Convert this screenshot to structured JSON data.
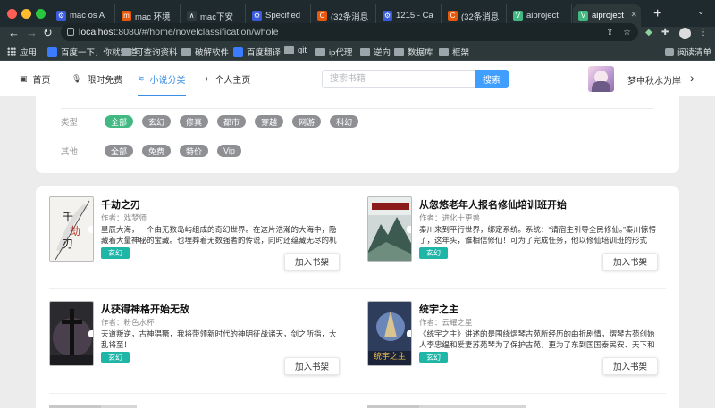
{
  "browser": {
    "tabs": [
      {
        "label": "mac os A",
        "fav_color": "#3b5bdb",
        "fav_glyph": "⚙"
      },
      {
        "label": "mac 环境",
        "fav_color": "#e8590c",
        "fav_glyph": "m"
      },
      {
        "label": "mac下安",
        "fav_color": "#2f3a3d",
        "fav_glyph": "∧"
      },
      {
        "label": "Specified",
        "fav_color": "#3b5bdb",
        "fav_glyph": "⚙"
      },
      {
        "label": "(32条消息",
        "fav_color": "#e8590c",
        "fav_glyph": "C"
      },
      {
        "label": "1215 - Ca",
        "fav_color": "#3b5bdb",
        "fav_glyph": "⚙"
      },
      {
        "label": "(32条消息",
        "fav_color": "#e8590c",
        "fav_glyph": "C"
      },
      {
        "label": "aiproject",
        "fav_color": "#42b983",
        "fav_glyph": "V"
      },
      {
        "label": "aiproject",
        "fav_color": "#42b983",
        "fav_glyph": "V"
      }
    ],
    "active_tab_index": 8,
    "url_host": "localhost",
    "url_path": ":8080/#/home/novelclassification/whole",
    "bookmarks": [
      {
        "label": "应用",
        "kind": "apps"
      },
      {
        "label": "百度一下，你就知道",
        "kind": "site",
        "color": "#3b7bff"
      },
      {
        "label": "可查询资料",
        "kind": "folder"
      },
      {
        "label": "破解软件",
        "kind": "folder"
      },
      {
        "label": "百度翻译",
        "kind": "site",
        "color": "#3b7bff"
      },
      {
        "label": "git",
        "kind": "folder"
      },
      {
        "label": "ip代理",
        "kind": "folder"
      },
      {
        "label": "逆向",
        "kind": "folder"
      },
      {
        "label": "数据库",
        "kind": "folder"
      },
      {
        "label": "框架",
        "kind": "folder"
      }
    ],
    "reading_list": "阅读清单"
  },
  "site_nav": {
    "items": [
      {
        "label": "首页",
        "icon": "▣",
        "active": false
      },
      {
        "label": "限时免费",
        "icon": "🎙",
        "active": false
      },
      {
        "label": "小说分类",
        "icon": "≋",
        "active": true
      },
      {
        "label": "个人主页",
        "icon": "◐",
        "active": false
      }
    ],
    "search_placeholder": "搜索书籍",
    "search_button": "搜索",
    "username": "梦中秋水为岸"
  },
  "filters": {
    "rows": [
      {
        "label": "类型",
        "chips": [
          "全部",
          "玄幻",
          "修真",
          "都市",
          "穿越",
          "网游",
          "科幻"
        ],
        "active_index": 0
      },
      {
        "label": "其他",
        "chips": [
          "全部",
          "免费",
          "特价",
          "Vip"
        ],
        "active_index": -1
      }
    ]
  },
  "books": [
    {
      "title": "千劫之刃",
      "author_prefix": "作者：",
      "author": "戏梦师",
      "description": "星辰大海，一个由无数岛屿组成的奇幻世界。在这片浩瀚的大海中，隐藏着大量神秘的宝藏。也埋葬着无数强者的传说，同时还蕴藏无尽的机遇…",
      "tag": "玄幻",
      "add_label": "加入书架",
      "cover": "blade"
    },
    {
      "title": "从忽悠老年人报名修仙培训班开始",
      "author_prefix": "作者：",
      "author": "进化十更兽",
      "description": "秦川来到平行世界，绑定系统。系统：“请宿主引导全民修仙。”秦川惊愕了，这年头，谁相信修仙！可为了完成任务，他以修仙培训班的形式拉…",
      "tag": "玄幻",
      "add_label": "加入书架",
      "cover": "mountain"
    },
    {
      "title": "从获得神格开始无敌",
      "author_prefix": "作者：",
      "author": "粉色水杯",
      "description": "天道叛逆，古神猖獗，我将带领新时代的神明征战诸天，剑之所指，大乱将至！",
      "tag": "玄幻",
      "add_label": "加入书架",
      "cover": "cross"
    },
    {
      "title": "统宇之主",
      "author_prefix": "作者：",
      "author": "云耀之星",
      "description": "《统宇之主》讲述的是围绕熠琴古苑所经历的曲折剧情，熠琴古苑创始人李忠缊和爱妻苏苑琴为了保护古苑，更为了东到国国泰民安、天下和祥…",
      "tag": "玄幻",
      "add_label": "加入书架",
      "cover": "fantasy"
    }
  ]
}
